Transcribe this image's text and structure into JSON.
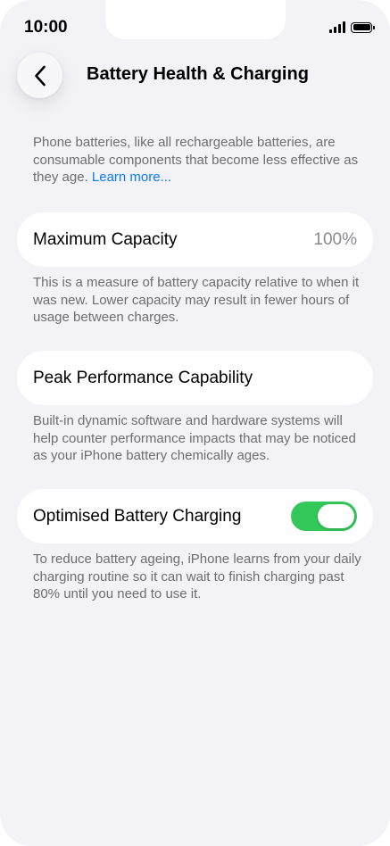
{
  "status_bar": {
    "time": "10:00"
  },
  "header": {
    "title": "Battery Health & Charging",
    "back_icon": "chevron-left-icon"
  },
  "intro": {
    "text": "Phone batteries, like all rechargeable batteries, are consumable components that become less effective as they age.",
    "link": "Learn more..."
  },
  "max_capacity": {
    "label": "Maximum Capacity",
    "value": "100%",
    "description": "This is a measure of battery capacity relative to when it was new. Lower capacity may result in fewer hours of usage between charges."
  },
  "peak_performance": {
    "label": "Peak Performance Capability",
    "description": "Built-in dynamic software and hardware systems will help counter performance impacts that may be noticed as your iPhone battery chemically ages."
  },
  "optimised_charging": {
    "label": "Optimised Battery Charging",
    "enabled": true,
    "toggle_color": "#34c759",
    "description": "To reduce battery ageing, iPhone learns from your daily charging routine so it can wait to finish charging past 80% until you need to use it."
  },
  "colors": {
    "background": "#f2f2f7",
    "card": "#ffffff",
    "link": "#0a7aff",
    "secondary_text": "#6d6d72"
  }
}
